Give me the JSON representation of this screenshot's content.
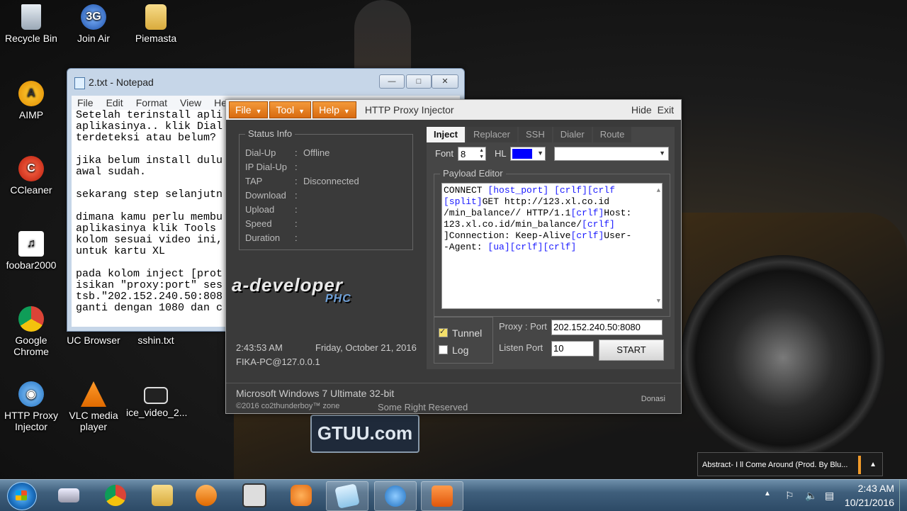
{
  "desktop": {
    "icons": [
      {
        "label": "Recycle Bin",
        "icon": "recycle-bin-icon"
      },
      {
        "label": "Join Air",
        "icon": "join-air-icon"
      },
      {
        "label": "Piemasta",
        "icon": "folder-icon"
      },
      {
        "label": "AIMP",
        "icon": "aimp-icon"
      },
      {
        "label": "CCleaner",
        "icon": "ccleaner-icon"
      },
      {
        "label": "foobar2000",
        "icon": "foobar-icon"
      },
      {
        "label": "Google Chrome",
        "icon": "chrome-icon"
      },
      {
        "label": "UC Browser",
        "icon": "uc-browser-icon"
      },
      {
        "label": "sshin.txt",
        "icon": "text-file-icon"
      },
      {
        "label": "HTTP Proxy Injector",
        "icon": "http-proxy-injector-icon"
      },
      {
        "label": "VLC media player",
        "icon": "vlc-icon"
      },
      {
        "label": "ice_video_2...",
        "icon": "video-file-icon"
      }
    ],
    "wallpaper_plate": "GTUU.com"
  },
  "notepad": {
    "title": "2.txt - Notepad",
    "menu": [
      "File",
      "Edit",
      "Format",
      "View",
      "Help"
    ],
    "lines": [
      "Setelah terinstall apli",
      "aplikasinya.. klik Dial",
      "terdeteksi atau belum?",
      "",
      "jika belum install dulu",
      "awal sudah.",
      "",
      "sekarang step selanjutn",
      "",
      "dimana kamu perlu membu",
      "aplikasinya klik Tools",
      "kolom sesuai video ini,",
      "untuk kartu XL",
      "",
      "pada kolom inject [prot",
      "isikan \"proxy:port\" ses",
      "tsb.\"202.152.240.50:808",
      "ganti dengan 1080 dan c"
    ]
  },
  "injector": {
    "menu": {
      "file": "File",
      "tool": "Tool",
      "help": "Help"
    },
    "title": "HTTP Proxy Injector",
    "hide": "Hide",
    "exit": "Exit",
    "status": {
      "legend": "Status Info",
      "rows": [
        {
          "key": "Dial-Up",
          "value": "Offline"
        },
        {
          "key": "IP Dial-Up",
          "value": ""
        },
        {
          "key": "TAP",
          "value": "Disconnected"
        },
        {
          "key": "Download",
          "value": ""
        },
        {
          "key": "Upload",
          "value": ""
        },
        {
          "key": "Speed",
          "value": ""
        },
        {
          "key": "Duration",
          "value": ""
        }
      ]
    },
    "logo_text": "a-developer",
    "logo_sub": "PHC",
    "clock": "2:43:53 AM",
    "date": "Friday, October 21, 2016",
    "host": "FIKA-PC@127.0.0.1",
    "os": "Microsoft Windows 7 Ultimate  32-bit",
    "copyright": "©2016  co2thunderboy™ zone",
    "rights": "Some Right Reserved",
    "donasi": "Donasi",
    "tabs": [
      "Inject",
      "Replacer",
      "SSH",
      "Dialer",
      "Route"
    ],
    "font_label": "Font",
    "font_value": "8",
    "hl_label": "HL",
    "hl_color": "#0000ff",
    "payload_legend": "Payload Editor",
    "payload_lines": [
      "CONNECT [host_port] [crlf][crlf",
      "[split]GET http://123.xl.co.id",
      "/min_balance// HTTP/1.1[crlf]Host:",
      " 123.xl.co.id/min_balance/[crlf]",
      "]Connection: Keep-Alive[crlf]User-",
      "-Agent: [ua][crlf][crlf]"
    ],
    "tunnel_label": "Tunnel",
    "tunnel_checked": true,
    "log_label": "Log",
    "log_checked": false,
    "proxy_label": "Proxy : Port",
    "proxy_value": "202.152.240.50:8080",
    "listen_label": "Listen Port",
    "listen_value": "10",
    "start_label": "START"
  },
  "media_popup": {
    "text": "Abstract- I ll Come Around (Prod. By Blu..."
  },
  "taskbar": {
    "apps": [
      "start",
      "keyboard",
      "chrome",
      "explorer",
      "media-player",
      "321-player",
      "uc-browser",
      "notepad",
      "http-proxy-injector",
      "screen-recorder"
    ],
    "time": "2:43 AM",
    "date": "10/21/2016"
  }
}
